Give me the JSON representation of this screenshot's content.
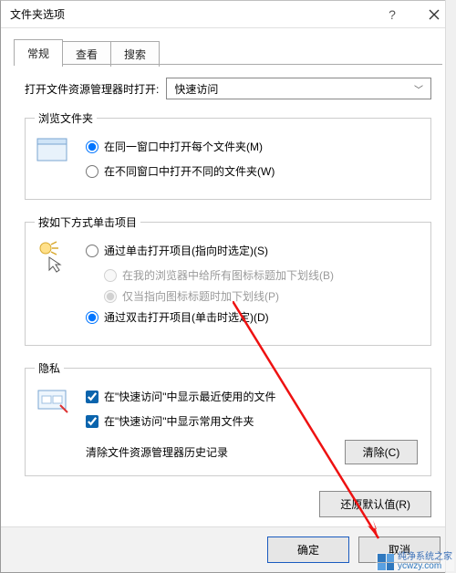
{
  "titlebar": {
    "title": "文件夹选项"
  },
  "tabs": [
    {
      "label": "常规"
    },
    {
      "label": "查看"
    },
    {
      "label": "搜索"
    }
  ],
  "open_row": {
    "label": "打开文件资源管理器时打开:",
    "value": "快速访问"
  },
  "browse_group": {
    "legend": "浏览文件夹",
    "opt_same": "在同一窗口中打开每个文件夹(M)",
    "opt_diff": "在不同窗口中打开不同的文件夹(W)"
  },
  "click_group": {
    "legend": "按如下方式单击项目",
    "opt_single": "通过单击打开项目(指向时选定)(S)",
    "sub_browser": "在我的浏览器中给所有图标标题加下划线(B)",
    "sub_point": "仅当指向图标标题时加下划线(P)",
    "opt_double": "通过双击打开项目(单击时选定)(D)"
  },
  "privacy_group": {
    "legend": "隐私",
    "chk_recent": "在\"快速访问\"中显示最近使用的文件",
    "chk_freq": "在\"快速访问\"中显示常用文件夹",
    "clear_label": "清除文件资源管理器历史记录",
    "clear_btn": "清除(C)"
  },
  "restore_btn": "还原默认值(R)",
  "footer": {
    "ok": "确定",
    "cancel": "取消"
  },
  "watermark": {
    "text": "纯净系统之家",
    "url": "ycwzy.com"
  }
}
